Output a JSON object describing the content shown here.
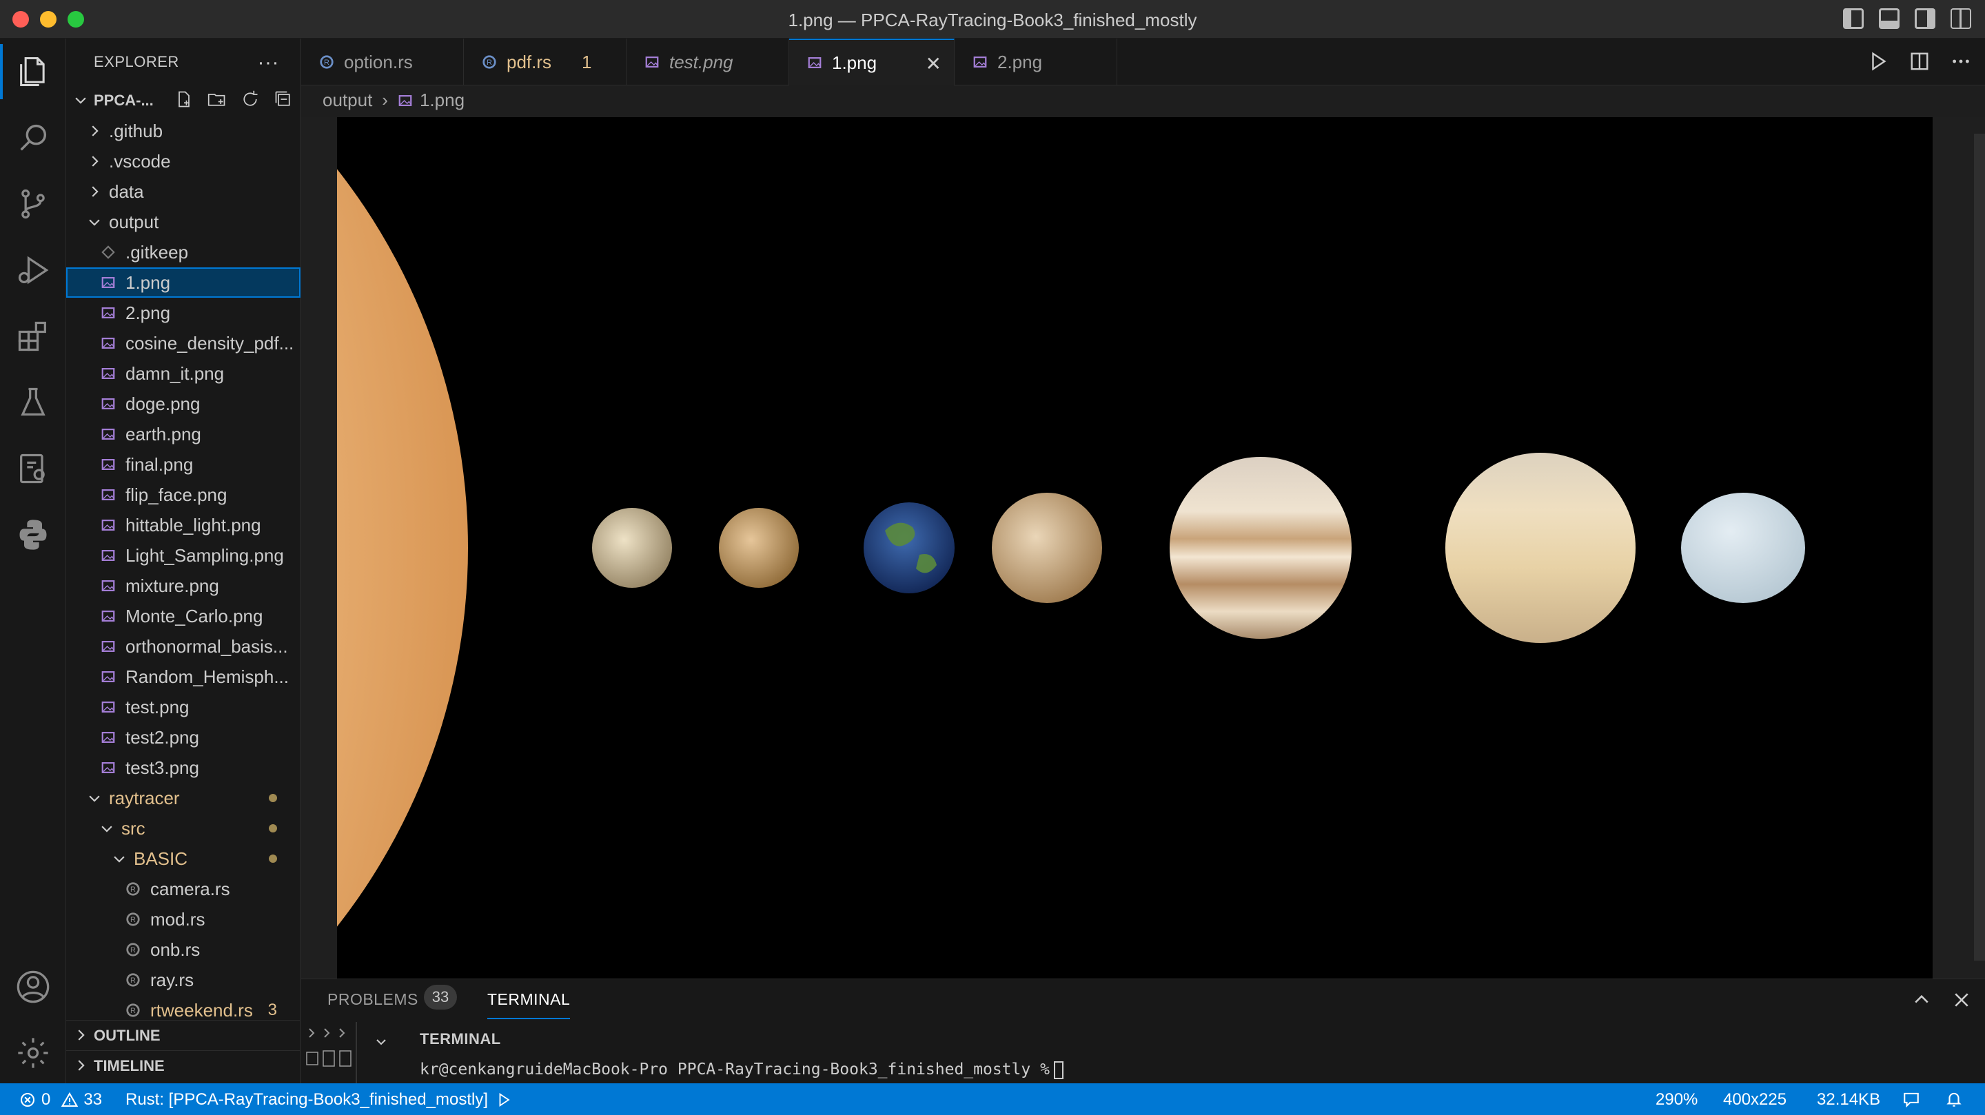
{
  "window": {
    "title": "1.png — PPCA-RayTracing-Book3_finished_mostly"
  },
  "explorer": {
    "title": "EXPLORER",
    "project": "PPCA-...",
    "tree": [
      {
        "label": ".github",
        "type": "folder",
        "depth": 1,
        "open": false
      },
      {
        "label": ".vscode",
        "type": "folder",
        "depth": 1,
        "open": false
      },
      {
        "label": "data",
        "type": "folder",
        "depth": 1,
        "open": false
      },
      {
        "label": "output",
        "type": "folder",
        "depth": 1,
        "open": true
      },
      {
        "label": ".gitkeep",
        "type": "file-git",
        "depth": 2
      },
      {
        "label": "1.png",
        "type": "image",
        "depth": 2,
        "selected": true
      },
      {
        "label": "2.png",
        "type": "image",
        "depth": 2
      },
      {
        "label": "cosine_density_pdf...",
        "type": "image",
        "depth": 2
      },
      {
        "label": "damn_it.png",
        "type": "image",
        "depth": 2
      },
      {
        "label": "doge.png",
        "type": "image",
        "depth": 2
      },
      {
        "label": "earth.png",
        "type": "image",
        "depth": 2
      },
      {
        "label": "final.png",
        "type": "image",
        "depth": 2
      },
      {
        "label": "flip_face.png",
        "type": "image",
        "depth": 2
      },
      {
        "label": "hittable_light.png",
        "type": "image",
        "depth": 2
      },
      {
        "label": "Light_Sampling.png",
        "type": "image",
        "depth": 2
      },
      {
        "label": "mixture.png",
        "type": "image",
        "depth": 2
      },
      {
        "label": "Monte_Carlo.png",
        "type": "image",
        "depth": 2
      },
      {
        "label": "orthonormal_basis...",
        "type": "image",
        "depth": 2
      },
      {
        "label": "Random_Hemisph...",
        "type": "image",
        "depth": 2
      },
      {
        "label": "test.png",
        "type": "image",
        "depth": 2
      },
      {
        "label": "test2.png",
        "type": "image",
        "depth": 2
      },
      {
        "label": "test3.png",
        "type": "image",
        "depth": 2
      },
      {
        "label": "raytracer",
        "type": "folder",
        "depth": 1,
        "open": true,
        "modified": true,
        "dot": true
      },
      {
        "label": "src",
        "type": "folder",
        "depth": 2,
        "open": true,
        "modified": true,
        "dot": true
      },
      {
        "label": "BASIC",
        "type": "folder",
        "depth": 3,
        "open": true,
        "modified": true,
        "dot": true
      },
      {
        "label": "camera.rs",
        "type": "rust",
        "depth": 4
      },
      {
        "label": "mod.rs",
        "type": "rust",
        "depth": 4
      },
      {
        "label": "onb.rs",
        "type": "rust",
        "depth": 4
      },
      {
        "label": "ray.rs",
        "type": "rust",
        "depth": 4
      },
      {
        "label": "rtweekend.rs",
        "type": "rust",
        "depth": 4,
        "modified": true,
        "count": "3"
      }
    ],
    "outline": "OUTLINE",
    "timeline": "TIMELINE"
  },
  "tabs": [
    {
      "label": "option.rs",
      "icon": "rust-icon",
      "italic": false
    },
    {
      "label": "pdf.rs",
      "icon": "rust-icon",
      "modified": true,
      "badge": "1"
    },
    {
      "label": "test.png",
      "icon": "image-icon",
      "italic": true
    },
    {
      "label": "1.png",
      "icon": "image-icon",
      "active": true
    },
    {
      "label": "2.png",
      "icon": "image-icon"
    }
  ],
  "breadcrumb": {
    "folder": "output",
    "file": "1.png"
  },
  "panel": {
    "problems_label": "PROBLEMS",
    "problems_count": "33",
    "terminal_label": "TERMINAL",
    "terminal_header": "TERMINAL",
    "terminal_line": "kr@cenkangruideMacBook-Pro PPCA-RayTracing-Book3_finished_mostly %"
  },
  "status": {
    "errors": "0",
    "warnings": "33",
    "rust": "Rust: [PPCA-RayTracing-Book3_finished_mostly]",
    "zoom": "290%",
    "dimensions": "400x225",
    "size": "32.14KB"
  },
  "colors": {
    "accent": "#0078d4",
    "statusbar": "#0078d4",
    "modified": "#e2c08d",
    "rust_icon": "#6b8fc7",
    "image_icon": "#a57fd8"
  }
}
